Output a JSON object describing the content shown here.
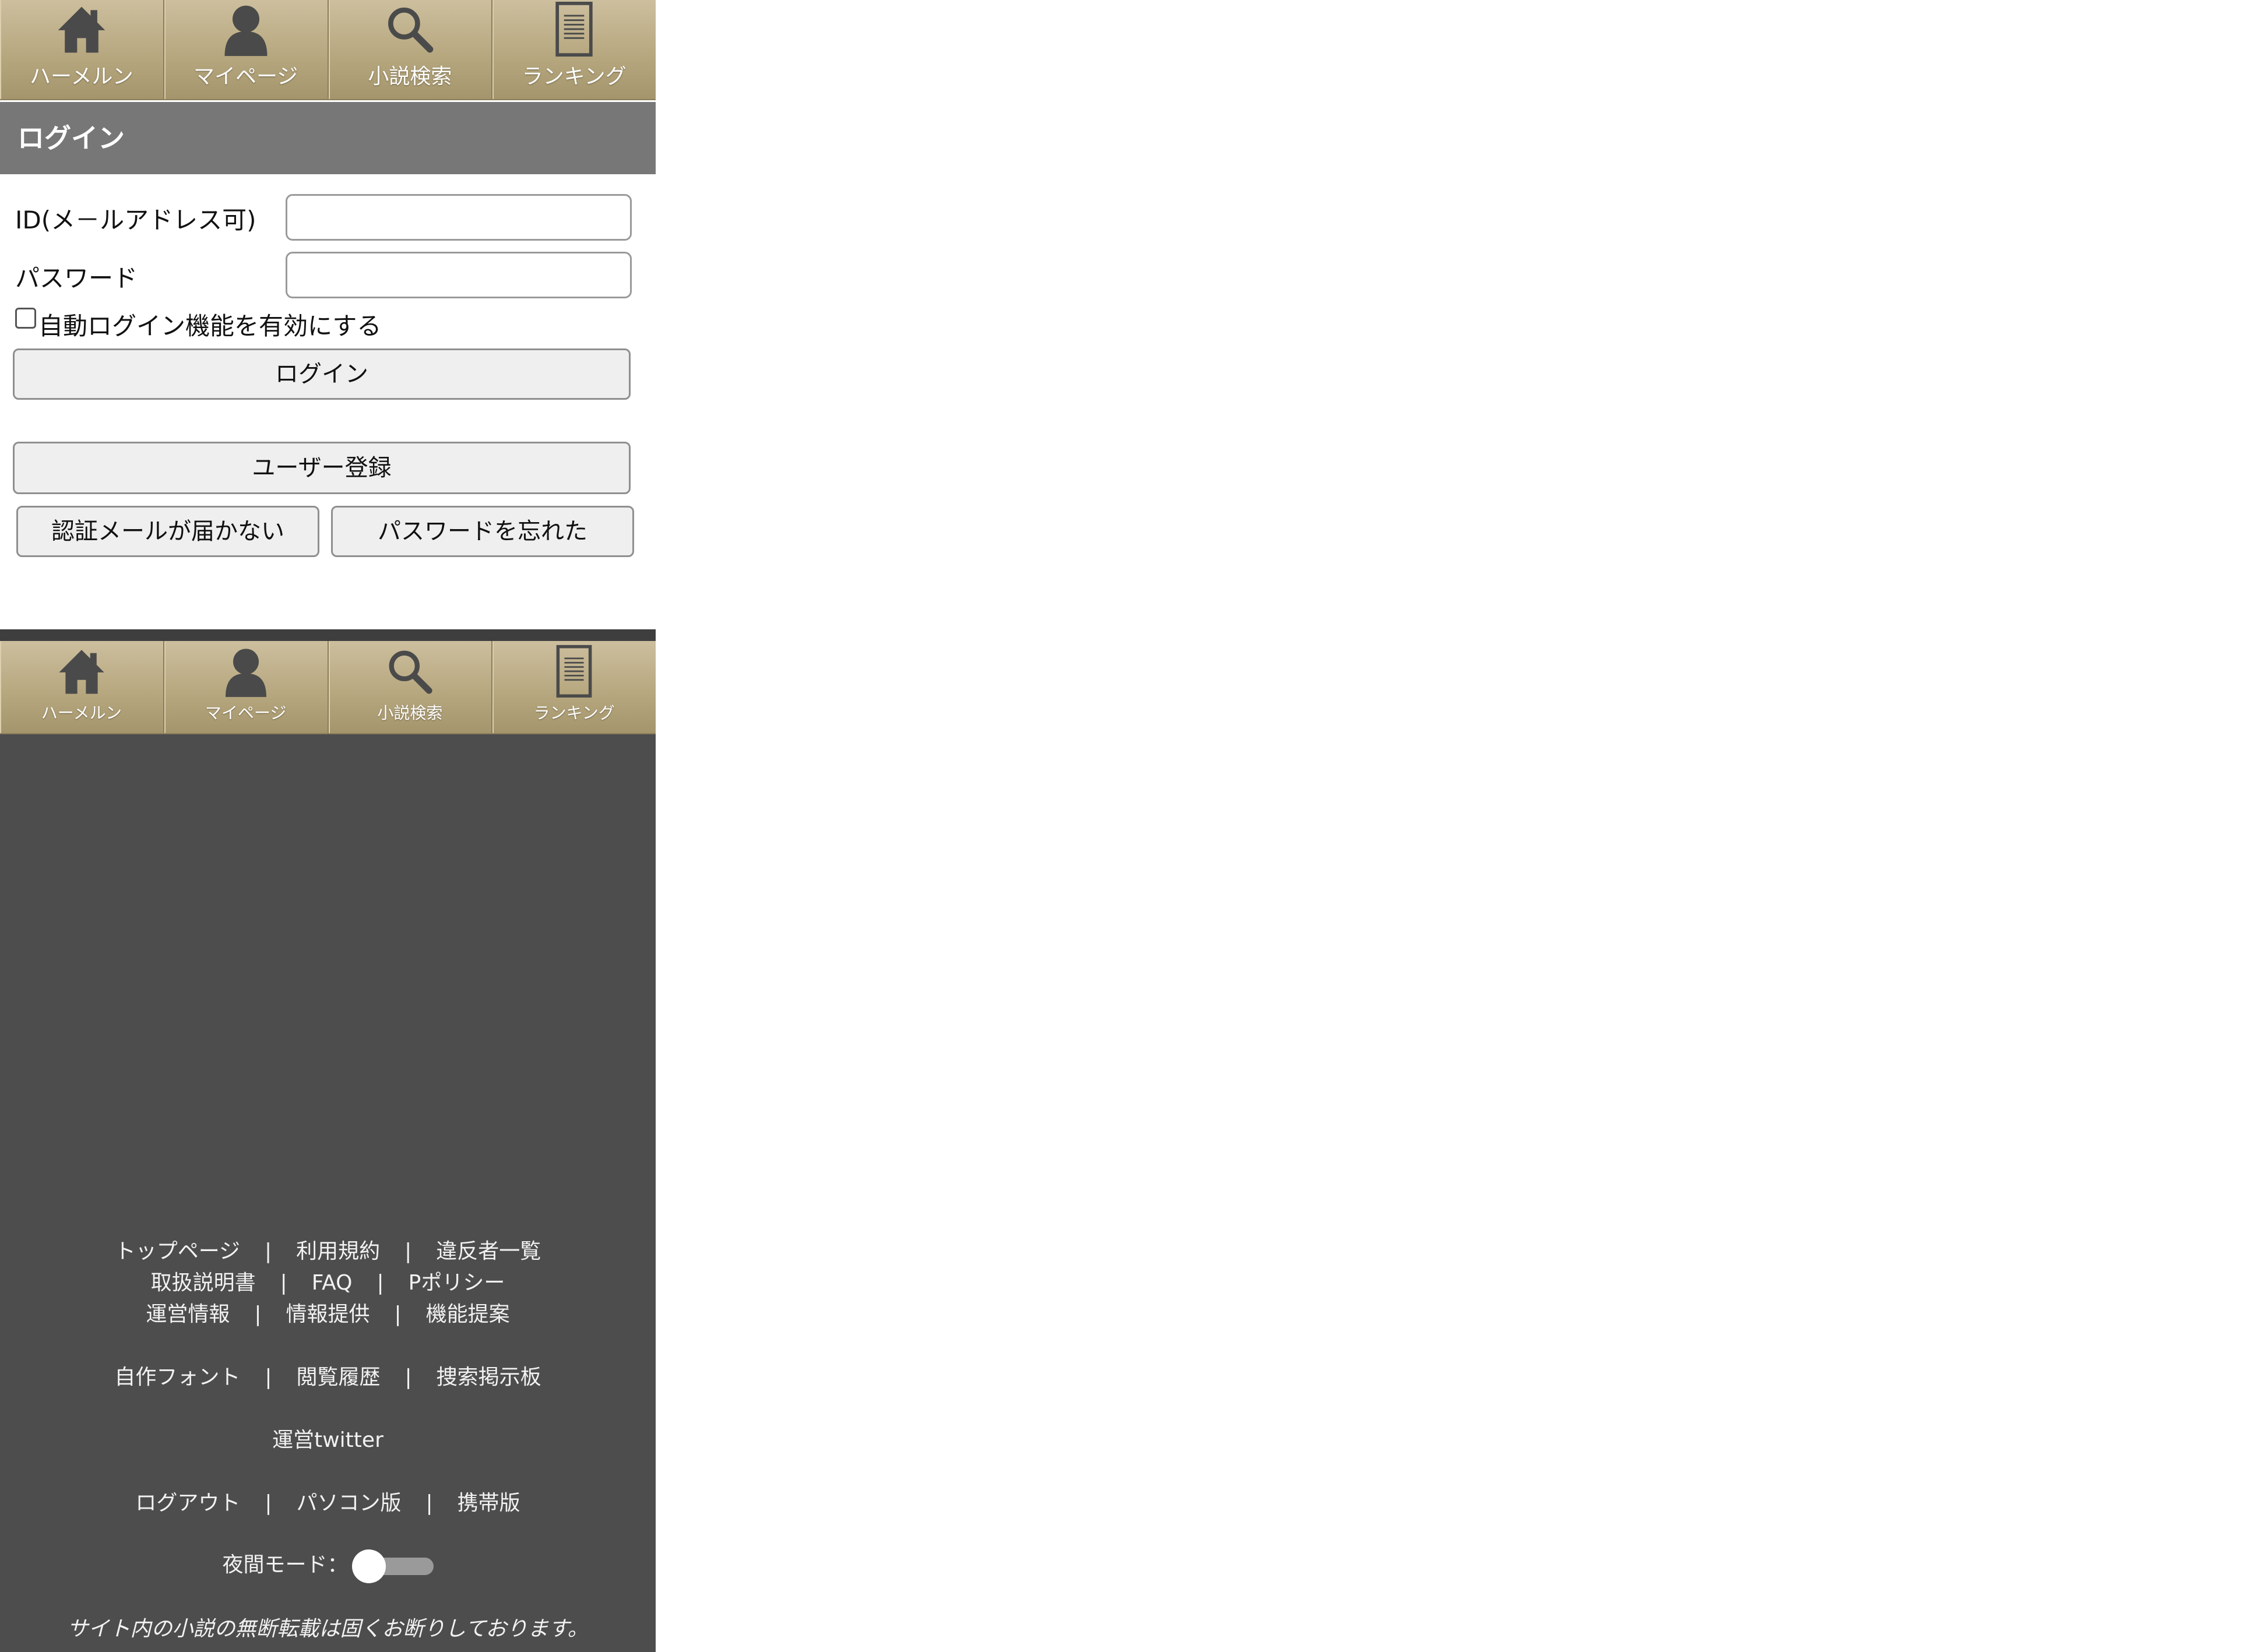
{
  "nav": {
    "items": [
      {
        "label": "ハーメルン",
        "icon": "home-icon"
      },
      {
        "label": "マイページ",
        "icon": "user-icon"
      },
      {
        "label": "小説検索",
        "icon": "search-icon"
      },
      {
        "label": "ランキング",
        "icon": "document-icon"
      }
    ]
  },
  "login": {
    "title": "ログイン",
    "id_label": "ID(メ－ルアドレス可)",
    "id_value": "",
    "password_label": "パスワード",
    "password_value": "",
    "auto_login_label": "自動ログイン機能を有効にする",
    "auto_login_checked": false,
    "login_button": "ログイン",
    "register_button": "ユーザー登録",
    "no_mail_button": "認証メールが届かない",
    "forgot_password_button": "パスワードを忘れた"
  },
  "footer": {
    "links_row1": [
      "トップページ",
      "利用規約",
      "違反者一覧"
    ],
    "links_row2": [
      "取扱説明書",
      "FAQ",
      "Pポリシー"
    ],
    "links_row3": [
      "運営情報",
      "情報提供",
      "機能提案"
    ],
    "links_row4": [
      "自作フォント",
      "閲覧履歴",
      "捜索掲示板"
    ],
    "links_row5": [
      "運営twitter"
    ],
    "links_row6": [
      "ログアウト",
      "パソコン版",
      "携帯版"
    ],
    "separator": "|",
    "night_mode_label": "夜間モード：",
    "night_mode_on": false,
    "notice": "サイト内の小説の無断転載は固くお断りしております。"
  },
  "colors": {
    "nav_gradient_top": "#cdbf9e",
    "nav_gradient_bottom": "#a4956c",
    "icon": "#4a4a4a",
    "section_header": "#777777",
    "footer_bg": "#4d4d4d"
  }
}
